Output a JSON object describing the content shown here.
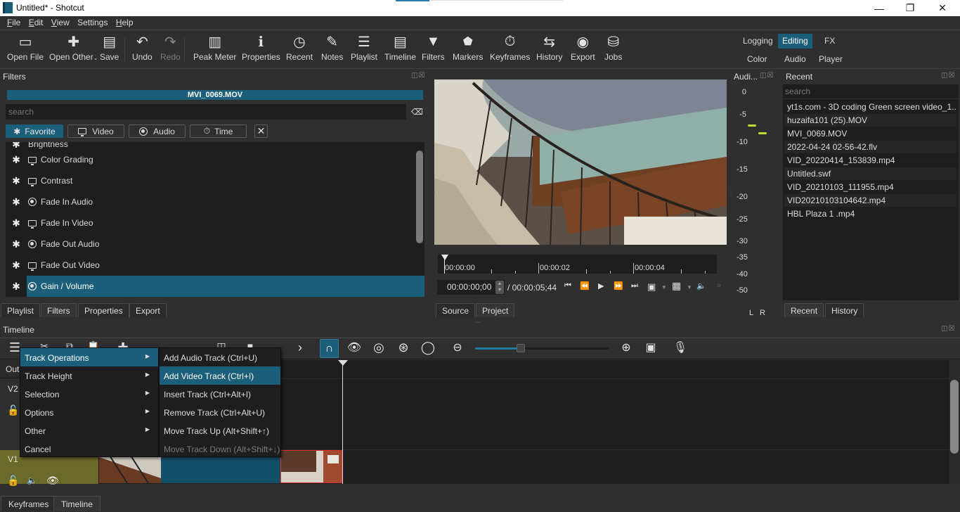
{
  "window": {
    "title": "Untitled* - Shotcut",
    "minimize": "—",
    "maximize": "❐",
    "close": "✕"
  },
  "menubar": {
    "items": [
      {
        "label": "File",
        "mnemonic": "F",
        "rest": "ile"
      },
      {
        "label": "Edit",
        "mnemonic": "E",
        "rest": "dit"
      },
      {
        "label": "View",
        "mnemonic": "V",
        "rest": "iew"
      },
      {
        "label": "Settings",
        "mnemonic": "",
        "rest": "Settings"
      },
      {
        "label": "Help",
        "mnemonic": "H",
        "rest": "elp"
      }
    ]
  },
  "toolbar": {
    "buttons": [
      {
        "label": "Open File",
        "icon": "folder-icon",
        "glyph": "🗀"
      },
      {
        "label": "Open Other",
        "icon": "open-other-icon",
        "glyph": "🗋"
      },
      {
        "label": "Save",
        "icon": "save-icon",
        "glyph": "🖫"
      },
      {
        "label": "Undo",
        "icon": "undo-icon",
        "glyph": "↶"
      },
      {
        "label": "Redo",
        "icon": "redo-icon",
        "glyph": "↷",
        "disabled": true
      },
      {
        "label": "Peak Meter",
        "icon": "peak-meter-icon",
        "glyph": "▥"
      },
      {
        "label": "Properties",
        "icon": "info-icon",
        "glyph": "ℹ"
      },
      {
        "label": "Recent",
        "icon": "clock-icon",
        "glyph": "◷"
      },
      {
        "label": "Notes",
        "icon": "notes-icon",
        "glyph": "✎"
      },
      {
        "label": "Playlist",
        "icon": "playlist-icon",
        "glyph": "☰"
      },
      {
        "label": "Timeline",
        "icon": "timeline-icon",
        "glyph": "▤"
      },
      {
        "label": "Filters",
        "icon": "funnel-icon",
        "glyph": "▼"
      },
      {
        "label": "Markers",
        "icon": "marker-icon",
        "glyph": "⬟"
      },
      {
        "label": "Keyframes",
        "icon": "stopwatch-icon",
        "glyph": "⏱"
      },
      {
        "label": "History",
        "icon": "history-icon",
        "glyph": "⇆"
      },
      {
        "label": "Export",
        "icon": "export-disc-icon",
        "glyph": "◉"
      },
      {
        "label": "Jobs",
        "icon": "database-icon",
        "glyph": "⛁"
      }
    ],
    "layouts": [
      {
        "label": "Logging",
        "active": false
      },
      {
        "label": "Editing",
        "active": true
      },
      {
        "label": "FX",
        "active": false
      },
      {
        "label": "Color",
        "active": false
      },
      {
        "label": "Audio",
        "active": false
      },
      {
        "label": "Player",
        "active": false
      }
    ]
  },
  "filters_panel": {
    "title": "Filters",
    "clip_name": "MVI_0069.MOV",
    "search_placeholder": "search",
    "categories": [
      {
        "label": "Favorite",
        "active": true
      },
      {
        "label": "Video",
        "active": false
      },
      {
        "label": "Audio",
        "active": false
      },
      {
        "label": "Time",
        "active": false
      }
    ],
    "partial_item": "Brightness",
    "items": [
      {
        "label": "Color Grading",
        "type": "video",
        "selected": false
      },
      {
        "label": "Contrast",
        "type": "video",
        "selected": false
      },
      {
        "label": "Fade In Audio",
        "type": "audio",
        "selected": false
      },
      {
        "label": "Fade In Video",
        "type": "video",
        "selected": false
      },
      {
        "label": "Fade Out Audio",
        "type": "audio",
        "selected": false
      },
      {
        "label": "Fade Out Video",
        "type": "video",
        "selected": false
      },
      {
        "label": "Gain / Volume",
        "type": "audio",
        "selected": true
      }
    ],
    "tabs": [
      {
        "label": "Playlist",
        "active": false
      },
      {
        "label": "Filters",
        "active": true
      },
      {
        "label": "Properties",
        "active": false
      },
      {
        "label": "Export",
        "active": false
      }
    ]
  },
  "player": {
    "ruler_labels": [
      "00:00:00",
      "00:00:02",
      "00:00:04"
    ],
    "timecode": "00:00:00;00",
    "duration": "/ 00:00:05;44",
    "tabs": [
      {
        "label": "Source",
        "active": false
      },
      {
        "label": "Project",
        "active": true
      }
    ]
  },
  "audio_meter": {
    "title": "Audi...",
    "scale": [
      "0",
      "-5",
      "-10",
      "-15",
      "-20",
      "-25",
      "-30",
      "-35",
      "-40",
      "-50"
    ],
    "channels": [
      "L",
      "R"
    ],
    "peaks_db": {
      "L": -7,
      "R": -8
    }
  },
  "recent_panel": {
    "title": "Recent",
    "search_placeholder": "search",
    "items": [
      "yt1s.com - 3D coding Green screen video_1...",
      "huzaifa101 (25).MOV",
      "MVI_0069.MOV",
      "2022-04-24 02-56-42.flv",
      "VID_20220414_153839.mp4",
      "Untitled.swf",
      "VID_20210103_111955.mp4",
      "VID20210103104642.mp4",
      "HBL Plaza 1 .mp4"
    ],
    "tabs": [
      {
        "label": "Recent",
        "active": true
      },
      {
        "label": "History",
        "active": false
      }
    ]
  },
  "timeline": {
    "title": "Timeline",
    "output_label": "Output",
    "tracks": [
      "V2",
      "V1"
    ],
    "zoom_level": 0.32,
    "context_menu": {
      "items": [
        {
          "label": "Track Operations",
          "submenu": true,
          "selected": true
        },
        {
          "label": "Track Height",
          "submenu": true
        },
        {
          "label": "Selection",
          "submenu": true
        },
        {
          "label": "Options",
          "submenu": true
        },
        {
          "label": "Other",
          "submenu": true
        },
        {
          "label": "Cancel",
          "submenu": false
        }
      ],
      "submenu": [
        {
          "label": "Add Audio Track (Ctrl+U)",
          "selected": false,
          "disabled": false
        },
        {
          "label": "Add Video Track (Ctrl+I)",
          "selected": true,
          "disabled": false
        },
        {
          "label": "Insert Track (Ctrl+Alt+I)",
          "selected": false,
          "disabled": false
        },
        {
          "label": "Remove Track (Ctrl+Alt+U)",
          "selected": false,
          "disabled": false
        },
        {
          "label": "Move Track Up (Alt+Shift+↑)",
          "selected": false,
          "disabled": false
        },
        {
          "label": "Move Track Down (Alt+Shift+↓)",
          "selected": false,
          "disabled": true
        }
      ]
    },
    "bottom_tabs": [
      {
        "label": "Keyframes",
        "active": false
      },
      {
        "label": "Timeline",
        "active": true
      }
    ]
  },
  "colors": {
    "accent": "#1b5f7b",
    "panel_bg": "#2f2f2f",
    "list_bg": "#1e1e1e",
    "track_v1": "#6a6a2a",
    "meter_peak": "#b8e02e"
  }
}
